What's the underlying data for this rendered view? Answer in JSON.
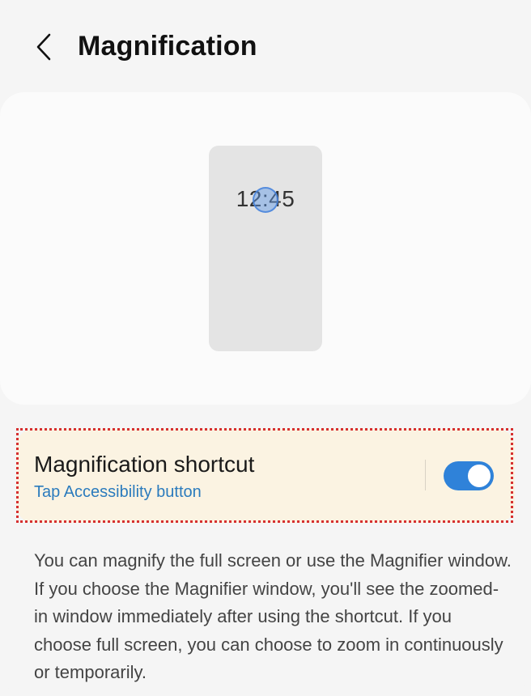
{
  "header": {
    "title": "Magnification",
    "back_icon": "chevron-left-icon"
  },
  "preview": {
    "clock_time": "12:45"
  },
  "shortcut": {
    "title": "Magnification shortcut",
    "subtitle": "Tap Accessibility button",
    "toggle_on": true,
    "accent_color": "#2f82d9",
    "highlight_color": "#d63030"
  },
  "description": "You can magnify the full screen or use the Magnifier window. If you choose the Magnifier window, you'll see the zoomed-in window immediately after using the shortcut. If you choose full screen, you can choose to zoom in continuously or temporarily."
}
